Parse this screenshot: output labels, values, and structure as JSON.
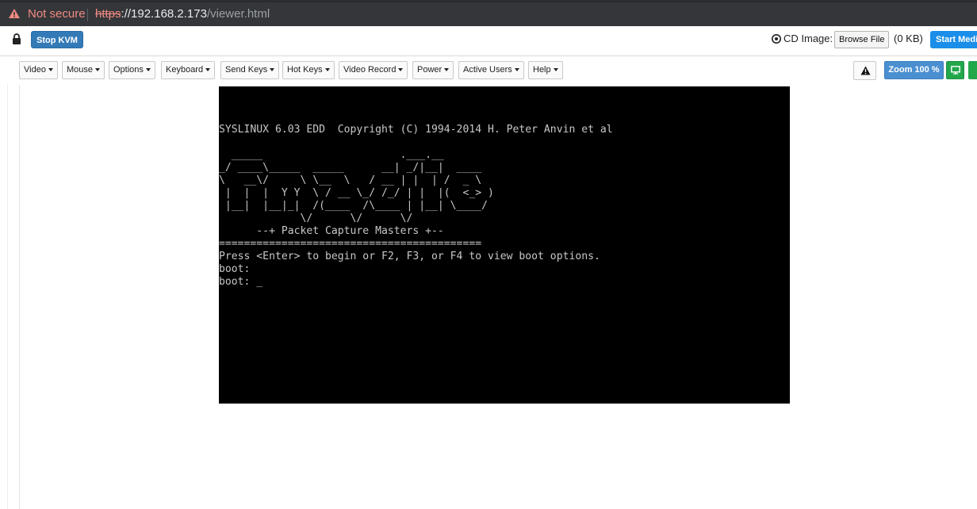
{
  "browser": {
    "security_label": "Not secure",
    "url_scheme": "https",
    "url_host": "://192.168.2.173",
    "url_path": "/viewer.html"
  },
  "topbar": {
    "stop_kvm_label": "Stop KVM",
    "cd_image_label": "CD Image:",
    "browse_file_label": "Browse File",
    "file_size": "(0 KB)",
    "start_media_label": "Start Media"
  },
  "menubar": {
    "items": [
      "Video",
      "Mouse",
      "Options",
      "Keyboard",
      "Send Keys",
      "Hot Keys",
      "Video Record",
      "Power",
      "Active Users",
      "Help"
    ],
    "zoom_label": "Zoom 100 %"
  },
  "console": {
    "lines": [
      "SYSLINUX 6.03 EDD  Copyright (C) 1994-2014 H. Peter Anvin et al",
      "",
      "  _____                      .___.__",
      "_/ ____\\_____  _____      __| _/|__|  ____",
      "\\   __\\/     \\ \\__  \\   / __ | |  | /  _ \\",
      " |  |  |  Y Y  \\ / __ \\_/ /_/ | |  |(  <_> )",
      " |__|  |__|_|  /(____  /\\____ | |__| \\____/",
      "             \\/      \\/      \\/",
      "      --+ Packet Capture Masters +--",
      "==========================================",
      "Press <Enter> to begin or F2, F3, or F4 to view boot options.",
      "boot:",
      "boot: _"
    ]
  },
  "colors": {
    "chrome_bar": "#35363a",
    "stop_kvm": "#337ab7",
    "zoom": "#4a8fd0",
    "green": "#22a74b",
    "console_bg": "#000000",
    "console_text": "#c7c7c7"
  },
  "icons": {
    "security": "warning-triangle-icon",
    "lock": "lock-icon",
    "cd": "cd-disc-icon",
    "alert": "alert-triangle-icon",
    "monitor": "monitor-icon"
  }
}
